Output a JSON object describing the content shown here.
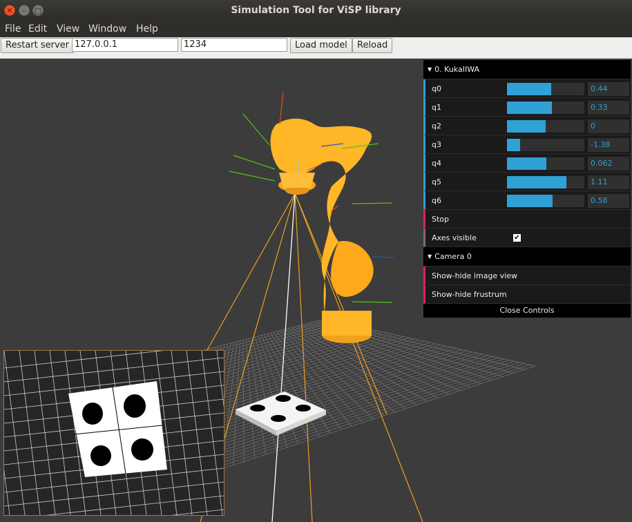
{
  "window": {
    "title": "Simulation Tool for ViSP library",
    "buttons": {
      "close": "✕",
      "minimize": "–",
      "maximize": "□"
    }
  },
  "menubar": {
    "items": [
      "File",
      "Edit",
      "View",
      "Window",
      "Help"
    ]
  },
  "toolbar": {
    "restart_label": "Restart server",
    "host_value": "127.0.0.1",
    "port_value": "1234",
    "load_model_label": "Load model",
    "reload_label": "Reload"
  },
  "controls": {
    "robot_folder": "0. KukaIIWA",
    "joints": [
      {
        "name": "q0",
        "value": "0.44",
        "fill": 0.57
      },
      {
        "name": "q1",
        "value": "0.33",
        "fill": 0.58
      },
      {
        "name": "q2",
        "value": "0",
        "fill": 0.5
      },
      {
        "name": "q3",
        "value": "-1.38",
        "fill": 0.17
      },
      {
        "name": "q4",
        "value": "0.062",
        "fill": 0.51
      },
      {
        "name": "q5",
        "value": "1.11",
        "fill": 0.77
      },
      {
        "name": "q6",
        "value": "0.58",
        "fill": 0.59
      }
    ],
    "stop_label": "Stop",
    "axes_label": "Axes visible",
    "axes_checked": true,
    "camera_folder": "Camera 0",
    "show_image_label": "Show-hide image view",
    "show_frustum_label": "Show-hide frustrum",
    "close_label": "Close Controls"
  },
  "colors": {
    "robot": "#ffb627",
    "slider": "#2fa1d6",
    "frustum": "#f0a020",
    "function_row": "#e61d5f"
  }
}
